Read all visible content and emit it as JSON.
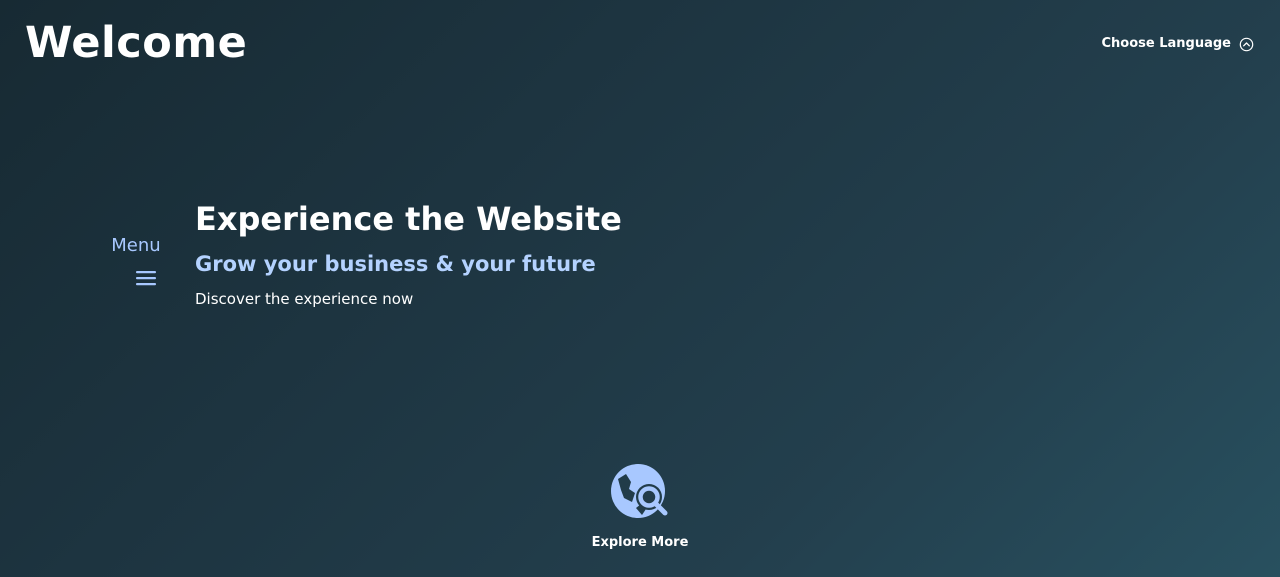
{
  "header": {
    "title": "Welcome",
    "language_label": "Choose Language",
    "language_icon": "chevron-up-circle-icon"
  },
  "menu": {
    "label": "Menu",
    "icon": "hamburger-menu-icon"
  },
  "hero": {
    "title": "Experience the Website",
    "subtitle": "Grow your business & your future",
    "text": "Discover the experience now"
  },
  "explore": {
    "label": "Explore More",
    "icon": "travel-explore-icon"
  },
  "colors": {
    "background_start": "#172a33",
    "background_end": "#28505f",
    "accent": "#a8c8ff",
    "subtitle": "#b4d2ff",
    "text": "#ffffff"
  }
}
